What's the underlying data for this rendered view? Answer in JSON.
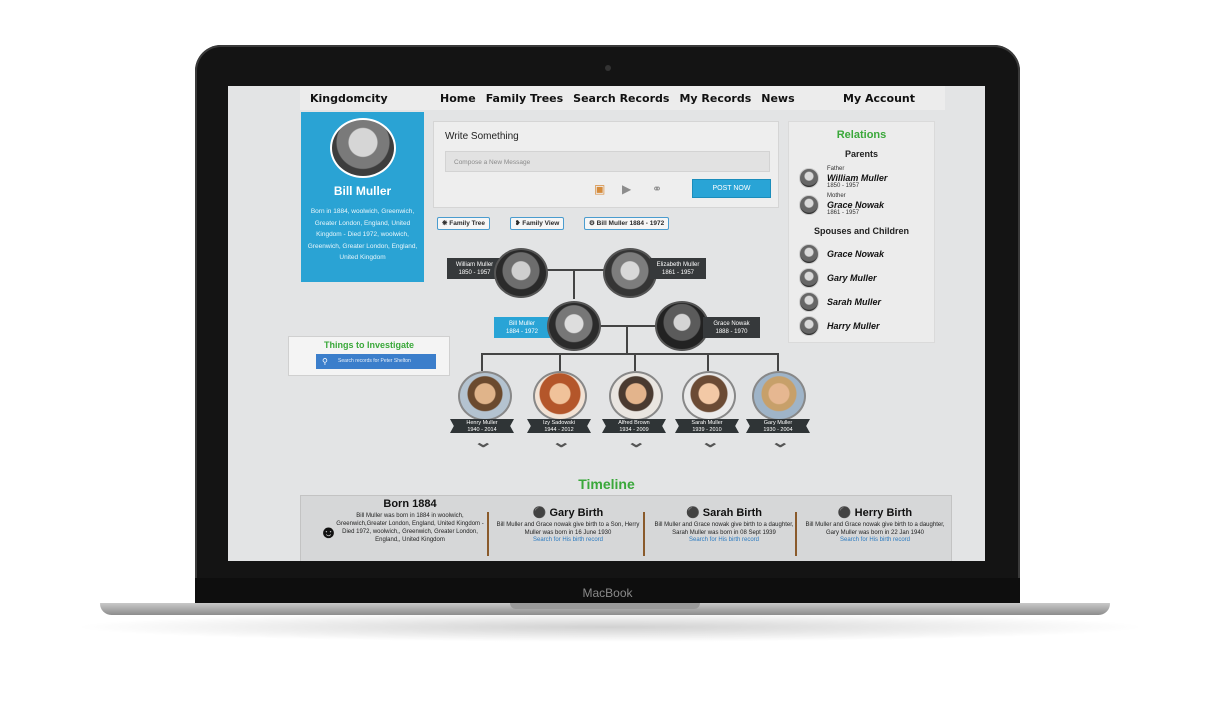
{
  "device": {
    "brand": "MacBook"
  },
  "nav": {
    "logo": "Kingdomcity",
    "items": [
      "Home",
      "Family Trees",
      "Search Records",
      "My Records",
      "News"
    ],
    "account": "My Account"
  },
  "profile": {
    "name": "Bill Muller",
    "bio": "Born in 1884, woolwich, Greenwich, Greater London, England, United Kingdom - Died 1972, woolwich, Greenwich, Greater London, England, United Kingdom"
  },
  "composer": {
    "title": "Write Something",
    "placeholder": "Compose a New Message",
    "post_label": "POST NOW"
  },
  "tabs": [
    "Family Tree",
    "Family View",
    "Bill Muller 1884 - 1972"
  ],
  "relations": {
    "title": "Relations",
    "parents_title": "Parents",
    "parents": [
      {
        "role": "Father",
        "name": "William Muller",
        "years": "1850 - 1957"
      },
      {
        "role": "Mother",
        "name": "Grace Nowak",
        "years": "1861 - 1957"
      }
    ],
    "spouses_title": "Spouses and Children",
    "spouses": [
      "Grace Nowak",
      "Gary Muller",
      "Sarah Muller",
      "Harry Muller"
    ]
  },
  "things": {
    "title": "Things to Investigate",
    "search_placeholder": "Search records for Peter Shelton"
  },
  "tree": {
    "father": {
      "name": "William Muller",
      "years": "1850 - 1957"
    },
    "mother": {
      "name": "Elizabeth Muller",
      "years": "1861 - 1957"
    },
    "self": {
      "name": "Bill Muller",
      "years": "1884 - 1972"
    },
    "spouse": {
      "name": "Grace Nowak",
      "years": "1888 - 1970"
    },
    "children": [
      {
        "name": "Henry Muller",
        "years": "1940 - 2014"
      },
      {
        "name": "Izy Sadowski",
        "years": "1944 - 2012"
      },
      {
        "name": "Alfred Brown",
        "years": "1934 - 2009"
      },
      {
        "name": "Sarah Muller",
        "years": "1939 - 2010"
      },
      {
        "name": "Gary Muller",
        "years": "1930 - 2004"
      }
    ]
  },
  "timeline": {
    "title": "Timeline",
    "events": [
      {
        "heading": "Born 1884",
        "text": "Bill Muller was born in 1884 in woolwich, Greenwich,Greater London, England, United Kingdom - Died 1972, woolwich,, Greenwich, Greater London, England,, United Kingdom",
        "link": ""
      },
      {
        "heading": "Gary Birth",
        "text": "Bill Muller and Grace nowak give birth to a Son, Herry Muller was born in 16 June 1930",
        "link": "Search for His birth record"
      },
      {
        "heading": "Sarah Birth",
        "text": "Bill Muller and Grace nowak give birth to a daughter, Sarah Muller was born in 08 Sept 1939",
        "link": "Search for His birth record"
      },
      {
        "heading": "Herry Birth",
        "text": "Bill Muller and Grace nowak give birth to a daughter, Gary Muller was born in 22 Jan 1940",
        "link": "Search for His birth record"
      }
    ]
  }
}
